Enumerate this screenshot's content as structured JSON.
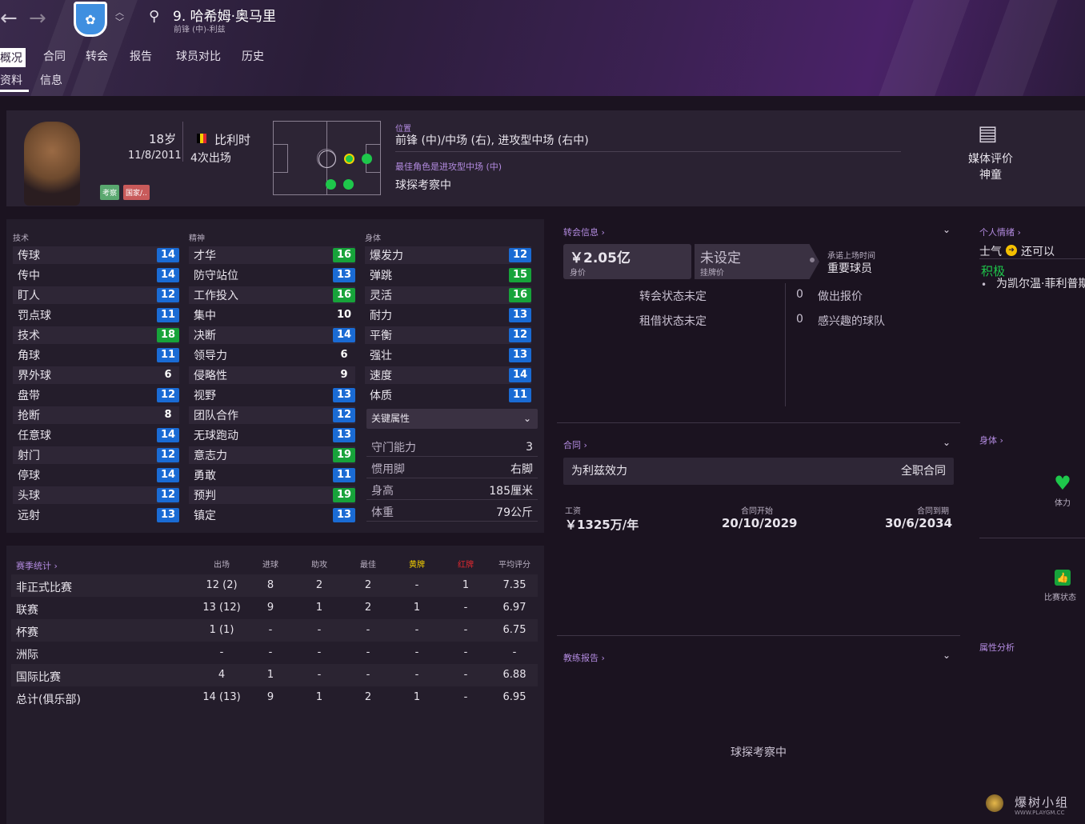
{
  "header": {
    "player_name": "9. 哈希姆·奥马里",
    "player_sub": "前锋 (中)-利兹",
    "tabs_row1": [
      "概况",
      "合同",
      "转会",
      "报告",
      "球员对比",
      "历史"
    ],
    "tabs_row2": [
      "资料",
      "信息"
    ]
  },
  "profile": {
    "age": "18岁",
    "dob": "11/8/2011",
    "nation": "比利时",
    "caps": "4次出场",
    "tags": [
      "考察",
      "国家/.."
    ],
    "position_label": "位置",
    "position_value": "前锋 (中)/中场 (右), 进攻型中场 (右中)",
    "best_role": "最佳角色是进攻型中场 (中)",
    "scout_status": "球探考察中",
    "media_label": "媒体评价",
    "media_value": "神童"
  },
  "attributes": {
    "tech_header": "技术",
    "mental_header": "精神",
    "phys_header": "身体",
    "technical": [
      {
        "n": "传球",
        "v": "14"
      },
      {
        "n": "传中",
        "v": "14"
      },
      {
        "n": "盯人",
        "v": "12"
      },
      {
        "n": "罚点球",
        "v": "11"
      },
      {
        "n": "技术",
        "v": "18"
      },
      {
        "n": "角球",
        "v": "11"
      },
      {
        "n": "界外球",
        "v": "6"
      },
      {
        "n": "盘带",
        "v": "12"
      },
      {
        "n": "抢断",
        "v": "8"
      },
      {
        "n": "任意球",
        "v": "14"
      },
      {
        "n": "射门",
        "v": "12"
      },
      {
        "n": "停球",
        "v": "14"
      },
      {
        "n": "头球",
        "v": "12"
      },
      {
        "n": "远射",
        "v": "13"
      }
    ],
    "mental": [
      {
        "n": "才华",
        "v": "16"
      },
      {
        "n": "防守站位",
        "v": "13"
      },
      {
        "n": "工作投入",
        "v": "16"
      },
      {
        "n": "集中",
        "v": "10"
      },
      {
        "n": "决断",
        "v": "14"
      },
      {
        "n": "领导力",
        "v": "6"
      },
      {
        "n": "侵略性",
        "v": "9"
      },
      {
        "n": "视野",
        "v": "13"
      },
      {
        "n": "团队合作",
        "v": "12"
      },
      {
        "n": "无球跑动",
        "v": "13"
      },
      {
        "n": "意志力",
        "v": "19"
      },
      {
        "n": "勇敢",
        "v": "11"
      },
      {
        "n": "预判",
        "v": "19"
      },
      {
        "n": "镇定",
        "v": "13"
      }
    ],
    "physical": [
      {
        "n": "爆发力",
        "v": "12"
      },
      {
        "n": "弹跳",
        "v": "15"
      },
      {
        "n": "灵活",
        "v": "16"
      },
      {
        "n": "耐力",
        "v": "13"
      },
      {
        "n": "平衡",
        "v": "12"
      },
      {
        "n": "强壮",
        "v": "13"
      },
      {
        "n": "速度",
        "v": "14"
      },
      {
        "n": "体质",
        "v": "11"
      }
    ],
    "key_label": "关键属性",
    "key": [
      {
        "k": "守门能力",
        "v": "3"
      },
      {
        "k": "惯用脚",
        "v": "右脚"
      },
      {
        "k": "身高",
        "v": "185厘米"
      },
      {
        "k": "体重",
        "v": "79公斤"
      }
    ]
  },
  "season_stats": {
    "title": "赛季统计 ›",
    "headers": [
      "出场",
      "进球",
      "助攻",
      "最佳",
      "黄牌",
      "红牌",
      "平均评分"
    ],
    "rows": [
      {
        "name": "非正式比赛",
        "c": [
          "12 (2)",
          "8",
          "2",
          "2",
          "-",
          "1",
          "7.35"
        ]
      },
      {
        "name": "联赛",
        "c": [
          "13 (12)",
          "9",
          "1",
          "2",
          "1",
          "-",
          "6.97"
        ]
      },
      {
        "name": "杯赛",
        "c": [
          "1 (1)",
          "-",
          "-",
          "-",
          "-",
          "-",
          "6.75"
        ]
      },
      {
        "name": "洲际",
        "c": [
          "-",
          "-",
          "-",
          "-",
          "-",
          "-",
          "-"
        ]
      },
      {
        "name": "国际比赛",
        "c": [
          "4",
          "1",
          "-",
          "-",
          "-",
          "-",
          "6.88"
        ]
      },
      {
        "name": "总计(俱乐部)",
        "c": [
          "14 (13)",
          "9",
          "1",
          "2",
          "1",
          "-",
          "6.95"
        ]
      }
    ]
  },
  "transfer": {
    "title": "转会信息 ›",
    "value": "￥2.05亿",
    "value_label": "身价",
    "asking": "未设定",
    "asking_label": "挂牌价",
    "playtime_label": "承诺上场时间",
    "playtime": "重要球员",
    "status1": "转会状态未定",
    "status2": "租借状态未定",
    "offers_n": "0",
    "offers": "做出报价",
    "interest_n": "0",
    "interest": "感兴趣的球队"
  },
  "contract": {
    "title": "合同 ›",
    "club": "为利兹效力",
    "type": "全职合同",
    "wage_label": "工资",
    "wage": "￥1325万/年",
    "start_label": "合同开始",
    "start": "20/10/2029",
    "end_label": "合同到期",
    "end": "30/6/2034"
  },
  "coach_report": {
    "title": "教练报告 ›",
    "status": "球探考察中"
  },
  "right": {
    "mood_title": "个人情绪 ›",
    "morale_label": "士气",
    "morale_value": "还可以",
    "positive": "积极",
    "bullet": "为凯尔温·菲利普斯失望",
    "body_title": "身体  ›",
    "fitness": "体力",
    "form": "比赛状态",
    "attr_analysis": "属性分析"
  },
  "watermark": {
    "text": "爆树小组",
    "url": "WWW.PLAYGM.CC"
  }
}
